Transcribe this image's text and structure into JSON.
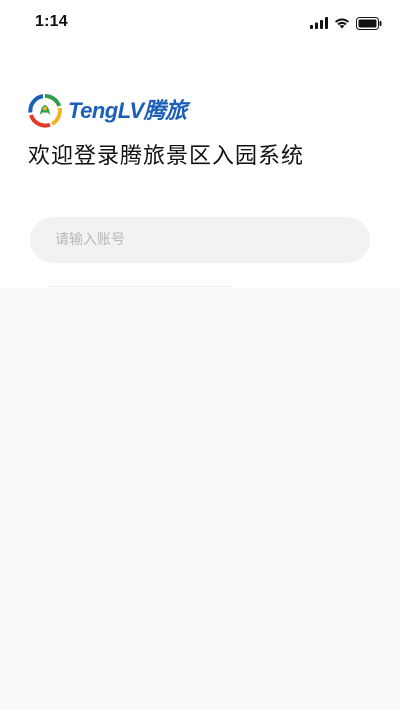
{
  "status_bar": {
    "time": "1:14",
    "icons": [
      "signal-icon",
      "wifi-icon",
      "battery-icon"
    ]
  },
  "brand": {
    "name": "TengLV腾旅",
    "color": "#1b5fb8",
    "logo_colors": [
      "#2e9e4a",
      "#f0b323",
      "#e23b2e",
      "#1b5fb8"
    ]
  },
  "headline": "欢迎登录腾旅景区入园系统",
  "account_field": {
    "value": "",
    "placeholder": "请输入账号"
  }
}
